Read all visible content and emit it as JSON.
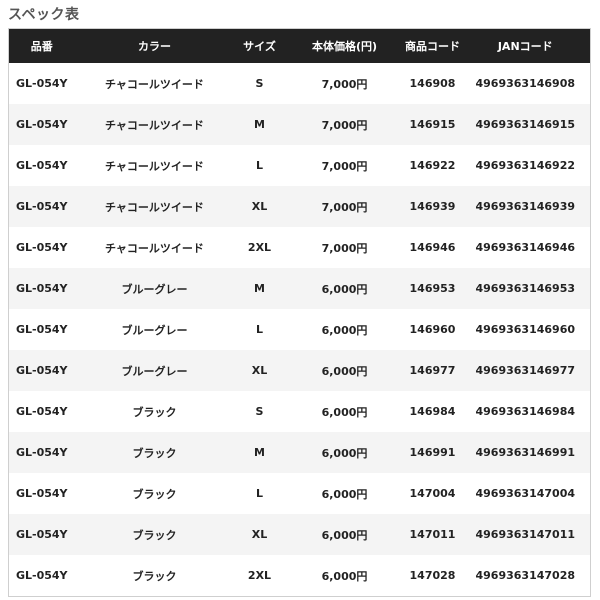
{
  "title": "スペック表",
  "headers": [
    "品番",
    "カラー",
    "サイズ",
    "本体価格(円)",
    "商品コード",
    "JANコード"
  ],
  "rows": [
    [
      "GL-054Y",
      "チャコールツイード",
      "S",
      "7,000円",
      "146908",
      "4969363146908"
    ],
    [
      "GL-054Y",
      "チャコールツイード",
      "M",
      "7,000円",
      "146915",
      "4969363146915"
    ],
    [
      "GL-054Y",
      "チャコールツイード",
      "L",
      "7,000円",
      "146922",
      "4969363146922"
    ],
    [
      "GL-054Y",
      "チャコールツイード",
      "XL",
      "7,000円",
      "146939",
      "4969363146939"
    ],
    [
      "GL-054Y",
      "チャコールツイード",
      "2XL",
      "7,000円",
      "146946",
      "4969363146946"
    ],
    [
      "GL-054Y",
      "ブルーグレー",
      "M",
      "6,000円",
      "146953",
      "4969363146953"
    ],
    [
      "GL-054Y",
      "ブルーグレー",
      "L",
      "6,000円",
      "146960",
      "4969363146960"
    ],
    [
      "GL-054Y",
      "ブルーグレー",
      "XL",
      "6,000円",
      "146977",
      "4969363146977"
    ],
    [
      "GL-054Y",
      "ブラック",
      "S",
      "6,000円",
      "146984",
      "4969363146984"
    ],
    [
      "GL-054Y",
      "ブラック",
      "M",
      "6,000円",
      "146991",
      "4969363146991"
    ],
    [
      "GL-054Y",
      "ブラック",
      "L",
      "6,000円",
      "147004",
      "4969363147004"
    ],
    [
      "GL-054Y",
      "ブラック",
      "XL",
      "6,000円",
      "147011",
      "4969363147011"
    ],
    [
      "GL-054Y",
      "ブラック",
      "2XL",
      "6,000円",
      "147028",
      "4969363147028"
    ]
  ],
  "colors": {
    "header_bg": "#222222",
    "header_text": "#ffffff",
    "row_alt_bg": "#f4f4f4",
    "title_text": "#555555"
  }
}
